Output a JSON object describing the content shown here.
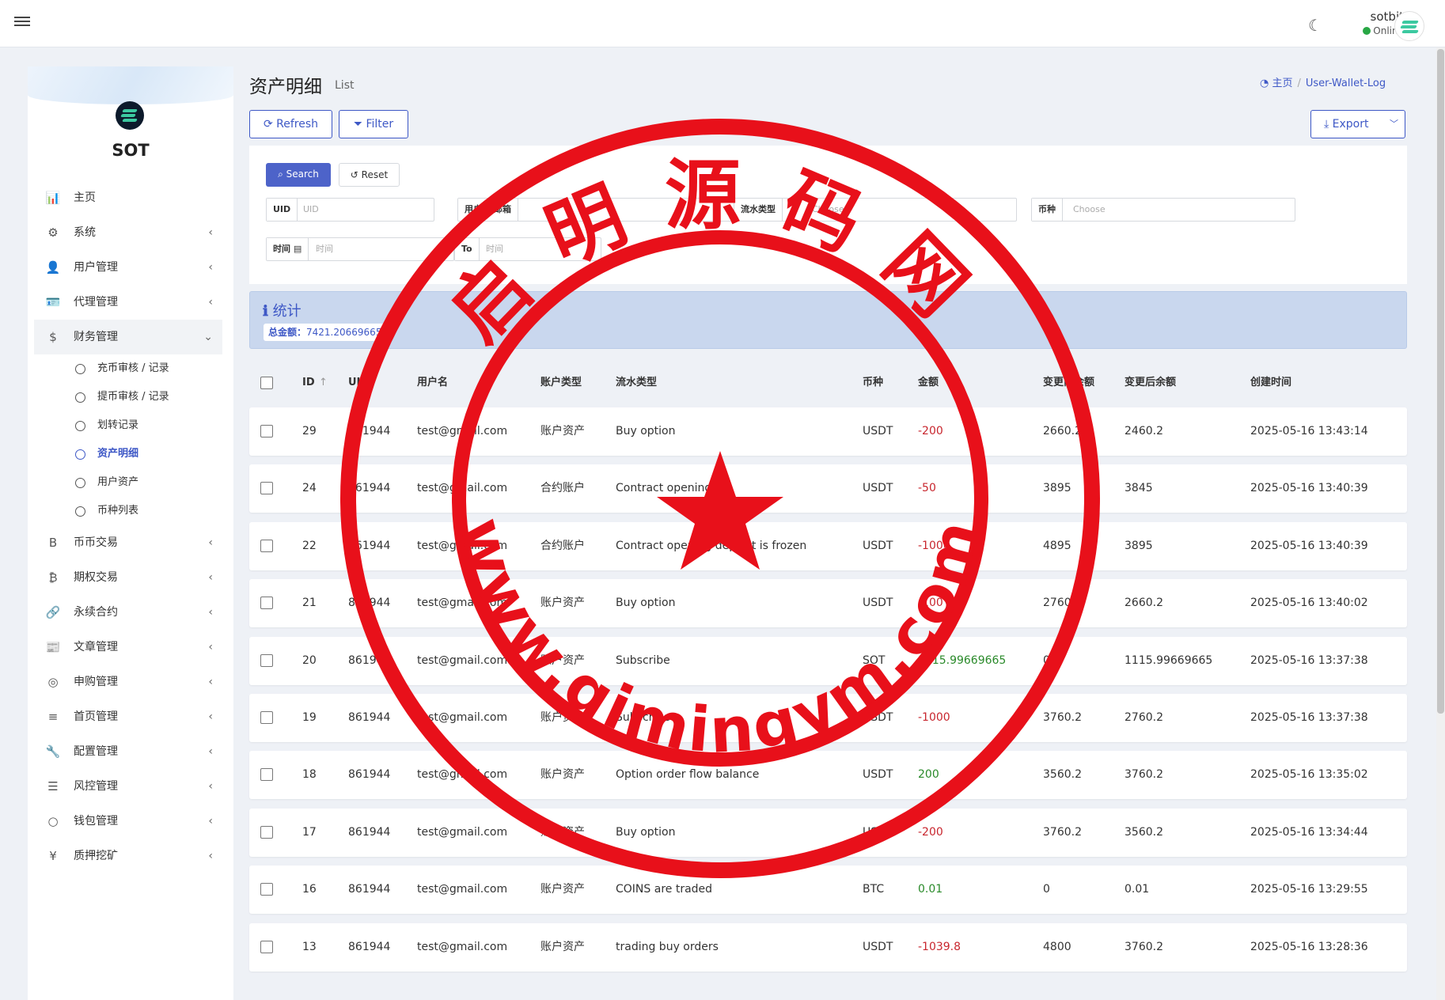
{
  "topbar": {
    "username": "sotbit",
    "status": "Online"
  },
  "brand": "SOT",
  "sidebar": {
    "items": [
      {
        "icon": "bar-chart-icon",
        "glyph": "📊",
        "label": "主页",
        "chevron": false
      },
      {
        "icon": "gear-icon",
        "glyph": "⚙",
        "label": "系统",
        "chevron": true
      },
      {
        "icon": "user-icon",
        "glyph": "👤",
        "label": "用户管理",
        "chevron": true
      },
      {
        "icon": "id-card-icon",
        "glyph": "🪪",
        "label": "代理管理",
        "chevron": true
      },
      {
        "icon": "dollar-icon",
        "glyph": "$",
        "label": "财务管理",
        "chevron": true,
        "open": true
      }
    ],
    "finance_sub": [
      "充币审核 / 记录",
      "提币审核 / 记录",
      "划转记录",
      "资产明细",
      "用户资产",
      "币种列表"
    ],
    "finance_active_index": 3,
    "items_after": [
      {
        "icon": "bitcoin-b-icon",
        "glyph": "B",
        "label": "币币交易"
      },
      {
        "icon": "bitcoin-icon",
        "glyph": "₿",
        "label": "期权交易"
      },
      {
        "icon": "link-icon",
        "glyph": "🔗",
        "label": "永续合约"
      },
      {
        "icon": "newspaper-icon",
        "glyph": "📰",
        "label": "文章管理"
      },
      {
        "icon": "lifebuoy-icon",
        "glyph": "◎",
        "label": "申购管理"
      },
      {
        "icon": "list-icon",
        "glyph": "≡",
        "label": "首页管理"
      },
      {
        "icon": "wrench-icon",
        "glyph": "🔧",
        "label": "配置管理"
      },
      {
        "icon": "indent-icon",
        "glyph": "☰",
        "label": "风控管理"
      },
      {
        "icon": "circle-icon",
        "glyph": "○",
        "label": "钱包管理"
      },
      {
        "icon": "yen-icon",
        "glyph": "¥",
        "label": "质押挖矿"
      }
    ]
  },
  "header": {
    "title": "资产明细",
    "subtitle": "List",
    "breadcrumb_home": "主页",
    "breadcrumb_current": "User-Wallet-Log"
  },
  "toolbar": {
    "refresh": "Refresh",
    "filter": "Filter",
    "export": "Export"
  },
  "filter": {
    "search": "Search",
    "reset": "Reset",
    "uid_label": "UID",
    "uid_placeholder": "UID",
    "user_label": "用户名/邮箱",
    "type_label": "流水类型",
    "type_placeholder": "Choose",
    "coin_label": "币种",
    "coin_placeholder": "Choose",
    "time_label": "时间",
    "time_placeholder": "时间",
    "to_label": "To",
    "to_placeholder": "时间"
  },
  "stats": {
    "title": "统计",
    "total_label": "总金额：",
    "total_value": "7421.20669665"
  },
  "table": {
    "headers": [
      "ID",
      "UID",
      "用户名",
      "账户类型",
      "流水类型",
      "币种",
      "金额",
      "变更前余额",
      "变更后余额",
      "创建时间"
    ],
    "rows": [
      {
        "id": "29",
        "uid": "861944",
        "user": "test@gmail.com",
        "account": "账户资产",
        "flow": "Buy option",
        "coin": "USDT",
        "amount": "-200",
        "sign": "neg",
        "before": "2660.2",
        "after": "2460.2",
        "time": "2025-05-16 13:43:14"
      },
      {
        "id": "24",
        "uid": "861944",
        "user": "test@gmail.com",
        "account": "合约账户",
        "flow": "Contract opening",
        "coin": "USDT",
        "amount": "-50",
        "sign": "neg",
        "before": "3895",
        "after": "3845",
        "time": "2025-05-16 13:40:39"
      },
      {
        "id": "22",
        "uid": "861944",
        "user": "test@gmail.com",
        "account": "合约账户",
        "flow": "Contract opening deposit is frozen",
        "coin": "USDT",
        "amount": "-1000",
        "sign": "neg",
        "before": "4895",
        "after": "3895",
        "time": "2025-05-16 13:40:39"
      },
      {
        "id": "21",
        "uid": "861944",
        "user": "test@gmail.com",
        "account": "账户资产",
        "flow": "Buy option",
        "coin": "USDT",
        "amount": "-100",
        "sign": "neg",
        "before": "2760.2",
        "after": "2660.2",
        "time": "2025-05-16 13:40:02"
      },
      {
        "id": "20",
        "uid": "861944",
        "user": "test@gmail.com",
        "account": "账户资产",
        "flow": "Subscribe",
        "coin": "SOT",
        "amount": "1115.99669665",
        "sign": "pos",
        "before": "0",
        "after": "1115.99669665",
        "time": "2025-05-16 13:37:38"
      },
      {
        "id": "19",
        "uid": "861944",
        "user": "test@gmail.com",
        "account": "账户资产",
        "flow": "Subscribe",
        "coin": "USDT",
        "amount": "-1000",
        "sign": "neg",
        "before": "3760.2",
        "after": "2760.2",
        "time": "2025-05-16 13:37:38"
      },
      {
        "id": "18",
        "uid": "861944",
        "user": "test@gmail.com",
        "account": "账户资产",
        "flow": "Option order flow balance",
        "coin": "USDT",
        "amount": "200",
        "sign": "pos",
        "before": "3560.2",
        "after": "3760.2",
        "time": "2025-05-16 13:35:02"
      },
      {
        "id": "17",
        "uid": "861944",
        "user": "test@gmail.com",
        "account": "账户资产",
        "flow": "Buy option",
        "coin": "USDT",
        "amount": "-200",
        "sign": "neg",
        "before": "3760.2",
        "after": "3560.2",
        "time": "2025-05-16 13:34:44"
      },
      {
        "id": "16",
        "uid": "861944",
        "user": "test@gmail.com",
        "account": "账户资产",
        "flow": "COINS are traded",
        "coin": "BTC",
        "amount": "0.01",
        "sign": "pos",
        "before": "0",
        "after": "0.01",
        "time": "2025-05-16 13:29:55"
      },
      {
        "id": "13",
        "uid": "861944",
        "user": "test@gmail.com",
        "account": "账户资产",
        "flow": "trading buy orders",
        "coin": "USDT",
        "amount": "-1039.8",
        "sign": "neg",
        "before": "4800",
        "after": "3760.2",
        "time": "2025-05-16 13:28:36"
      }
    ]
  },
  "watermark": {
    "top_text": "启明源码网",
    "bottom_text": "www.qimingym.com",
    "color": "#e8101a"
  }
}
